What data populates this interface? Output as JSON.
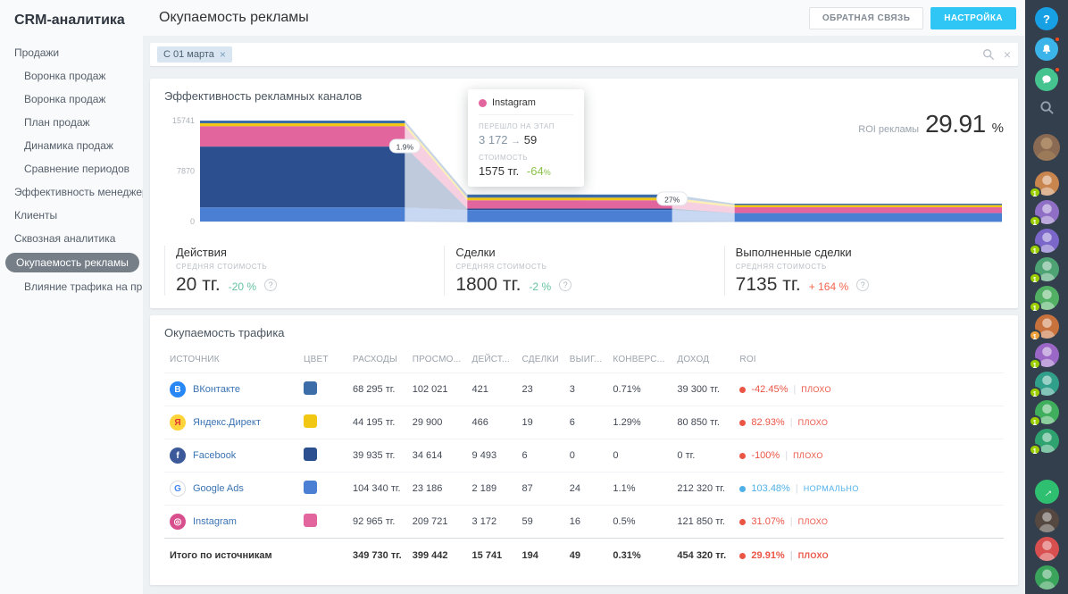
{
  "app": {
    "brand": "CRM-аналитика"
  },
  "sidebar": {
    "items": [
      {
        "label": "Продажи",
        "indent": 0,
        "active": false
      },
      {
        "label": "Воронка продаж",
        "indent": 1,
        "active": false
      },
      {
        "label": "Воронка продаж",
        "indent": 1,
        "active": false
      },
      {
        "label": "План продаж",
        "indent": 1,
        "active": false
      },
      {
        "label": "Динамика продаж",
        "indent": 1,
        "active": false
      },
      {
        "label": "Сравнение периодов",
        "indent": 1,
        "active": false
      },
      {
        "label": "Эффективность менеджер...",
        "indent": 0,
        "active": false
      },
      {
        "label": "Клиенты",
        "indent": 0,
        "active": false
      },
      {
        "label": "Сквозная аналитика",
        "indent": 0,
        "active": false
      },
      {
        "label": "Окупаемость рекламы",
        "indent": 1,
        "active": true
      },
      {
        "label": "Влияние трафика на пр...",
        "indent": 1,
        "active": false
      }
    ]
  },
  "header": {
    "title": "Окупаемость рекламы",
    "feedback_label": "ОБРАТНАЯ СВЯЗЬ",
    "settings_label": "НАСТРОЙКА"
  },
  "filter": {
    "chip": "С 01 марта",
    "remove_icon": "×",
    "clear_icon": "×"
  },
  "chart_data": {
    "type": "funnel",
    "title": "Эффективность рекламных каналов",
    "roi_label": "ROI рекламы",
    "roi_value": "29.91",
    "roi_unit": "%",
    "y_ticks": [
      15741,
      7870,
      0
    ],
    "stage_names": [
      "Действия",
      "Сделки",
      "Выполненные сделки"
    ],
    "stage_totals": [
      15741,
      194,
      49
    ],
    "badges": [
      "1.9%",
      "27%"
    ],
    "stack_order": [
      0,
      1,
      4,
      2,
      3
    ],
    "series": [
      {
        "name": "ВКонтакте",
        "color": "#3d6da8",
        "values": [
          421,
          23,
          3
        ]
      },
      {
        "name": "Яндекс.Директ",
        "color": "#f2c714",
        "values": [
          466,
          19,
          6
        ]
      },
      {
        "name": "Facebook",
        "color": "#2c4f8f",
        "values": [
          9493,
          6,
          0
        ]
      },
      {
        "name": "Google Ads",
        "color": "#4a7fd4",
        "values": [
          2189,
          87,
          24
        ]
      },
      {
        "name": "Instagram",
        "color": "#e2659d",
        "values": [
          3172,
          59,
          16
        ]
      }
    ]
  },
  "tooltip": {
    "source": "Instagram",
    "color": "#e2659d",
    "stage_label": "ПЕРЕШЛО НА ЭТАП",
    "from": "3 172",
    "arrow": "→",
    "to": "59",
    "cost_label": "СТОИМОСТЬ",
    "cost": "1575 тг.",
    "delta": "-64",
    "delta_unit": "%",
    "delta_color": "#8bc34a"
  },
  "stats": [
    {
      "title": "Действия",
      "sub": "СРЕДНЯЯ СТОИМОСТЬ",
      "value": "20 тг.",
      "delta": "-20 %",
      "delta_color": "#66c2a0",
      "help": "?"
    },
    {
      "title": "Сделки",
      "sub": "СРЕДНЯЯ СТОИМОСТЬ",
      "value": "1800 тг.",
      "delta": "-2 %",
      "delta_color": "#66c2a0",
      "help": "?"
    },
    {
      "title": "Выполненные сделки",
      "sub": "СРЕДНЯЯ СТОИМОСТЬ",
      "value": "7135 тг.",
      "delta": "+ 164 %",
      "delta_color": "#f2654d",
      "help": "?"
    }
  ],
  "table": {
    "title": "Окупаемость трафика",
    "columns": [
      "ИСТОЧНИК",
      "ЦВЕТ",
      "РАСХОДЫ",
      "ПРОСМО...",
      "ДЕЙСТ...",
      "СДЕЛКИ",
      "ВЫИГ...",
      "КОНВЕРС...",
      "ДОХОД",
      "ROI"
    ],
    "rows": [
      {
        "name": "ВКонтакте",
        "icon_glyph": "В",
        "icon_bg": "#2787f5",
        "icon_fg": "#ffffff",
        "swatch": "#3d6da8",
        "expenses": "68 295 тг.",
        "views": "102 021",
        "actions": "421",
        "deals": "23",
        "won": "3",
        "conversion": "0.71%",
        "income": "39 300 тг.",
        "roi_value": "-42.45%",
        "roi_status": "ПЛОХО",
        "roi_color": "#eb5545"
      },
      {
        "name": "Яндекс.Директ",
        "icon_glyph": "Я",
        "icon_bg": "#ffd43b",
        "icon_fg": "#e03131",
        "swatch": "#f2c714",
        "expenses": "44 195 тг.",
        "views": "29 900",
        "actions": "466",
        "deals": "19",
        "won": "6",
        "conversion": "1.29%",
        "income": "80 850 тг.",
        "roi_value": "82.93%",
        "roi_status": "ПЛОХО",
        "roi_color": "#eb5545"
      },
      {
        "name": "Facebook",
        "icon_glyph": "f",
        "icon_bg": "#3c5a99",
        "icon_fg": "#ffffff",
        "swatch": "#2c4f8f",
        "expenses": "39 935 тг.",
        "views": "34 614",
        "actions": "9 493",
        "deals": "6",
        "won": "0",
        "conversion": "0",
        "income": "0 тг.",
        "roi_value": "-100%",
        "roi_status": "ПЛОХО",
        "roi_color": "#eb5545"
      },
      {
        "name": "Google Ads",
        "icon_glyph": "G",
        "icon_bg": "#ffffff",
        "icon_fg": "#4285f4",
        "icon_border": "#dadce0",
        "swatch": "#4a7fd4",
        "expenses": "104 340 тг.",
        "views": "23 186",
        "actions": "2 189",
        "deals": "87",
        "won": "24",
        "conversion": "1.1%",
        "income": "212 320 тг.",
        "roi_value": "103.48%",
        "roi_status": "НОРМАЛЬНО",
        "roi_color": "#4fb0e8"
      },
      {
        "name": "Instagram",
        "icon_glyph": "◎",
        "icon_bg": "#d84f8e",
        "icon_fg": "#ffffff",
        "swatch": "#e2659d",
        "expenses": "92 965 тг.",
        "views": "209 721",
        "actions": "3 172",
        "deals": "59",
        "won": "16",
        "conversion": "0.5%",
        "income": "121 850 тг.",
        "roi_value": "31.07%",
        "roi_status": "ПЛОХО",
        "roi_color": "#eb5545"
      }
    ],
    "total": {
      "label": "Итого по источникам",
      "expenses": "349 730 тг.",
      "views": "399 442",
      "actions": "15 741",
      "deals": "194",
      "won": "49",
      "conversion": "0.31%",
      "income": "454 320 тг.",
      "roi_value": "29.91%",
      "roi_status": "ПЛОХО",
      "roi_color": "#eb5545"
    }
  },
  "rail": {
    "help": {
      "glyph": "?",
      "bg": "#18a0e4"
    },
    "notifications": {
      "bg": "#3bb5e9"
    },
    "messenger": {
      "bg": "#45c490"
    },
    "profile": {
      "bg": "#8a6a52"
    },
    "contacts": [
      {
        "bg": "#c8854e",
        "badge": "1",
        "badge_bg": "#9dcf00"
      },
      {
        "bg": "#8f6fc6",
        "badge": "1",
        "badge_bg": "#9dcf00"
      },
      {
        "bg": "#7a67c9",
        "badge": "1",
        "badge_bg": "#9dcf00"
      },
      {
        "bg": "#4da373",
        "badge": "1",
        "badge_bg": "#9dcf00"
      },
      {
        "bg": "#52b065",
        "badge": "1",
        "badge_bg": "#9dcf00"
      },
      {
        "bg": "#c7723d",
        "badge": "1",
        "badge_bg": "#f0a23c"
      },
      {
        "bg": "#9a67c6",
        "badge": "1",
        "badge_bg": "#9dcf00"
      },
      {
        "bg": "#31a08b",
        "badge": "1",
        "badge_bg": "#9dcf00"
      },
      {
        "bg": "#3fae5d",
        "badge": "1",
        "badge_bg": "#9dcf00"
      },
      {
        "bg": "#2fa36f",
        "badge": "1",
        "badge_bg": "#9dcf00"
      }
    ],
    "bottom": [
      {
        "bg": "#2fbf71",
        "glyph": "→"
      },
      {
        "bg": "#554840"
      },
      {
        "bg": "#d84f4f"
      },
      {
        "bg": "#3aa35c"
      }
    ]
  }
}
